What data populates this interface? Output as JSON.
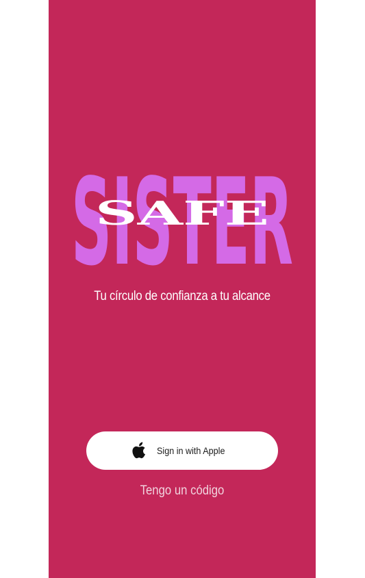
{
  "brand": {
    "word_back": "SISTER",
    "word_front": "SAFE"
  },
  "tagline": "Tu círculo de confianza a tu alcance",
  "sign_in": {
    "label": "Sign in with Apple",
    "icon": "apple-icon"
  },
  "code_link": "Tengo un código",
  "colors": {
    "background": "#c32759",
    "logo_back": "#d46ae6",
    "logo_front": "#ffffff",
    "button_bg": "#ffffff",
    "button_text": "#1a1a1a",
    "link_text": "#f1d3de"
  }
}
